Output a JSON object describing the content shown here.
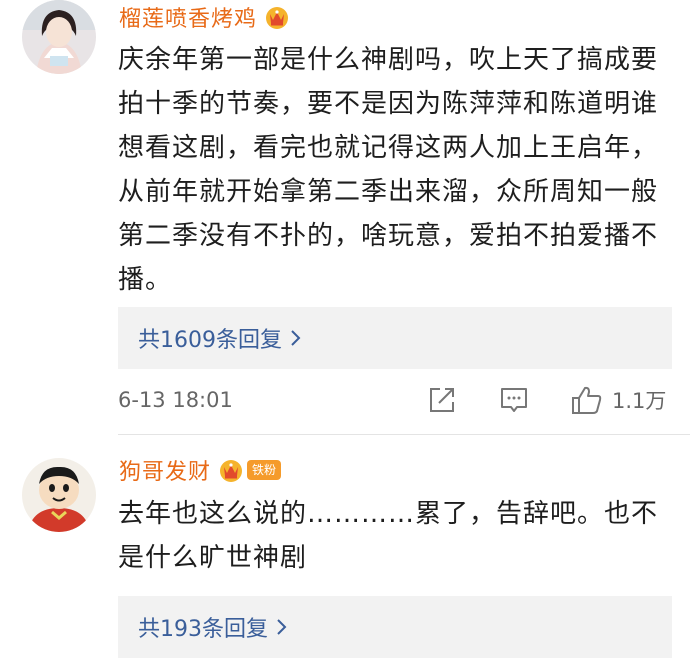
{
  "comments": [
    {
      "username": "榴莲喷香烤鸡",
      "text": "庆余年第一部是什么神剧吗，吹上天了搞成要拍十季的节奏，要不是因为陈萍萍和陈道明谁想看这剧，看完也就记得这两人加上王启年，从前年就开始拿第二季出来溜，众所周知一般第二季没有不扑的，啥玩意，爱拍不拍爱播不播。",
      "replies_label": "共1609条回复",
      "timestamp": "6-13 18:01",
      "likes": "1.1万"
    },
    {
      "username": "狗哥发财",
      "badge": "铁粉",
      "text": "去年也这么说的…………累了，告辞吧。也不是什么旷世神剧",
      "replies_label": "共193条回复"
    }
  ],
  "colors": {
    "username": "#e86a17",
    "reply_link": "#3a5e9a",
    "reply_bg": "#f2f2f2",
    "meta_text": "#666666"
  },
  "icons": [
    "crown-icon",
    "chevron-right-icon",
    "share-icon",
    "comment-icon",
    "like-icon"
  ]
}
